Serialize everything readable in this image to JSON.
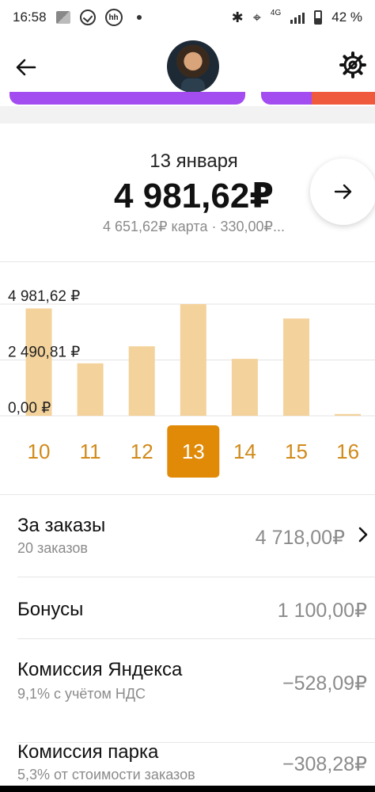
{
  "status_bar": {
    "time": "16:58",
    "network": "4G",
    "battery": "42 %"
  },
  "header": {
    "back_icon": "arrow-left-icon",
    "settings_icon": "gear-icon"
  },
  "summary": {
    "date": "13 января",
    "total": "4 981,62₽",
    "breakdown": "4 651,62₽ карта · 330,00₽...",
    "next_icon": "arrow-right-icon"
  },
  "chart_data": {
    "type": "bar",
    "categories": [
      "10",
      "11",
      "12",
      "13",
      "14",
      "15",
      "16"
    ],
    "values": [
      4790,
      2340,
      3100,
      4981.62,
      2540,
      4340,
      80
    ],
    "selected_category": "13",
    "y_tick_labels": [
      "4 981,62 ₽",
      "2 490,81 ₽",
      "0,00 ₽"
    ],
    "ylim": [
      0,
      4981.62
    ],
    "bar_color": "#f3d29b",
    "selected_color": "#e08a08",
    "grid": true
  },
  "rows": [
    {
      "title": "За заказы",
      "subtitle": "20 заказов",
      "value": "4 718,00₽",
      "has_chevron": true
    },
    {
      "title": "Бонусы",
      "subtitle": "",
      "value": "1 100,00₽",
      "has_chevron": false
    },
    {
      "title": "Комиссия Яндекса",
      "subtitle": "9,1% с учётом НДС",
      "value": "−528,09₽",
      "has_chevron": false
    },
    {
      "title": "Комиссия парка",
      "subtitle": "5,3% от стоимости заказов",
      "value": "−308,28₽",
      "has_chevron": false
    }
  ],
  "colors": {
    "accent_orange": "#e08a08",
    "promo_purple": "#a34cf0",
    "promo_red": "#f05a3c"
  }
}
